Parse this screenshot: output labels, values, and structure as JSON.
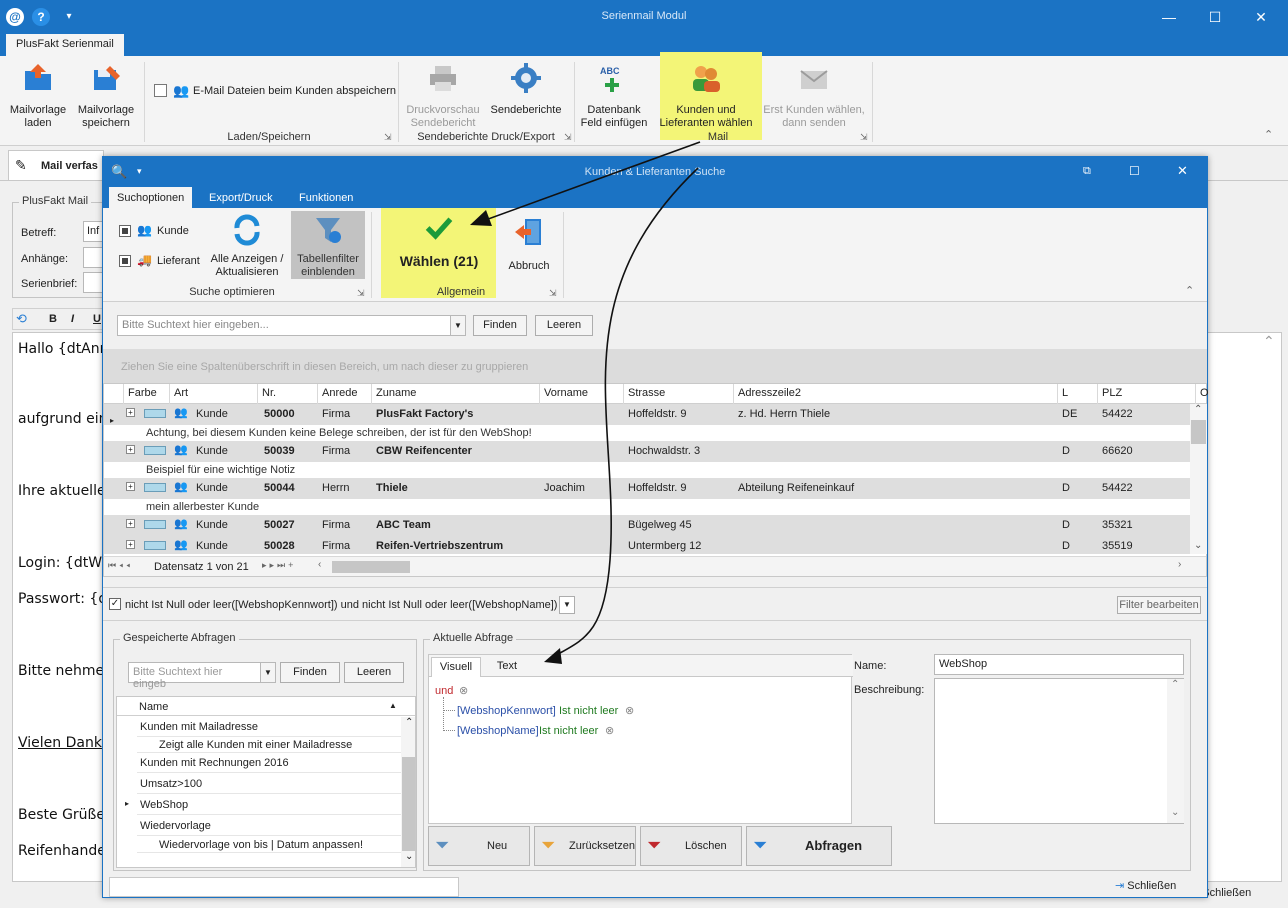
{
  "app": {
    "title": "Serienmail Modul",
    "quick_access": [
      "@",
      "?",
      "▾"
    ],
    "window_controls": [
      "—",
      "☐",
      "✕"
    ]
  },
  "main_ribbon": {
    "tab": "PlusFakt Serienmail",
    "buttons": {
      "mailvorlage_laden": [
        "Mailvorlage",
        "laden"
      ],
      "mailvorlage_speichern": [
        "Mailvorlage",
        "speichern"
      ],
      "email_dateien_checkbox": "E-Mail Dateien beim Kunden abspeichern",
      "druckvorschau": [
        "Druckvorschau",
        "Sendebericht"
      ],
      "sendeberichte": "Sendeberichte",
      "datenbank_feld": [
        "Datenbank",
        "Feld einfügen"
      ],
      "kunden_lieferanten": [
        "Kunden und",
        "Lieferanten wählen"
      ],
      "erst_kunden": [
        "Erst Kunden wählen,",
        "dann senden"
      ]
    },
    "groups": {
      "laden_speichern": "Laden/Speichern",
      "sendeberichte": "Sendeberichte Druck/Export",
      "mail": "Mail"
    }
  },
  "background": {
    "tab_mail": "Mail verfas",
    "plusfakt_mail": "PlusFakt Mail",
    "fields": {
      "betreff_label": "Betreff:",
      "betreff_value": "Inf",
      "anhaenge_label": "Anhänge:",
      "serienbrief_label": "Serienbrief:"
    },
    "editor_toolbar": [
      "B",
      "I",
      "U"
    ],
    "editor_lines": [
      "Hallo {dtAnr",
      "aufgrund ein",
      "Ihre aktuelle",
      "Login: {dtWe",
      "Passwort: {d",
      "Bitte nehme",
      "Vielen Dank",
      "Beste Grüße",
      "Reifenhande"
    ],
    "statusbar_close": "Schließen"
  },
  "dialog": {
    "title": "Kunden & Lieferanten Suche",
    "tabs": [
      "Suchoptionen",
      "Export/Druck",
      "Funktionen"
    ],
    "ribbon": {
      "check_kunde": "Kunde",
      "check_lieferant": "Lieferant",
      "alle_anzeigen": [
        "Alle Anzeigen /",
        "Aktualisieren"
      ],
      "tabellenfilter": [
        "Tabellenfilter",
        "einblenden"
      ],
      "waehlen": "Wählen (21)",
      "abbruch": "Abbruch",
      "group_suche": "Suche optimieren",
      "group_allgemein": "Allgemein"
    },
    "search": {
      "placeholder": "Bitte Suchtext hier eingeben...",
      "find": "Finden",
      "clear": "Leeren"
    },
    "group_hint": "Ziehen Sie eine Spaltenüberschrift in diesen Bereich, um nach dieser zu gruppieren",
    "grid": {
      "columns": [
        "Farbe",
        "Art",
        "Nr.",
        "Anrede",
        "Zuname",
        "Vorname",
        "Strasse",
        "Adresszeile2",
        "L",
        "PLZ",
        "O"
      ],
      "rows": [
        {
          "art": "Kunde",
          "nr": "50000",
          "anrede": "Firma",
          "zuname": "PlusFakt Factory's",
          "vorname": "",
          "strasse": "Hoffeldstr. 9",
          "adresse2": "z. Hd. Herrn Thiele",
          "land": "DE",
          "plz": "54422",
          "note": "Achtung, bei diesem Kunden keine Belege schreiben, der ist für den WebShop!"
        },
        {
          "art": "Kunde",
          "nr": "50039",
          "anrede": "Firma",
          "zuname": "CBW Reifencenter",
          "vorname": "",
          "strasse": "Hochwaldstr. 3",
          "adresse2": "",
          "land": "D",
          "plz": "66620",
          "note": "Beispiel für eine wichtige Notiz"
        },
        {
          "art": "Kunde",
          "nr": "50044",
          "anrede": "Herrn",
          "zuname": "Thiele",
          "vorname": "Joachim",
          "strasse": "Hoffeldstr. 9",
          "adresse2": "Abteilung Reifeneinkauf",
          "land": "D",
          "plz": "54422",
          "note": "mein allerbester Kunde"
        },
        {
          "art": "Kunde",
          "nr": "50027",
          "anrede": "Firma",
          "zuname": "ABC Team",
          "vorname": "",
          "strasse": "Bügelweg 45",
          "adresse2": "",
          "land": "D",
          "plz": "35321",
          "note": ""
        },
        {
          "art": "Kunde",
          "nr": "50028",
          "anrede": "Firma",
          "zuname": "Reifen-Vertriebszentrum",
          "vorname": "",
          "strasse": "Untermberg 12",
          "adresse2": "",
          "land": "D",
          "plz": "35519",
          "note": ""
        }
      ],
      "navigator": "Datensatz 1 von 21"
    },
    "filter_text": "nicht Ist Null oder leer([WebshopKennwort]) und nicht Ist Null oder leer([WebshopName])",
    "filter_edit": "Filter bearbeiten",
    "saved_queries": {
      "legend": "Gespeicherte Abfragen",
      "placeholder": "Bitte Suchtext hier eingeb",
      "find": "Finden",
      "clear": "Leeren",
      "header": "Name",
      "items": [
        {
          "text": "Kunden mit Mailadresse",
          "sub": false
        },
        {
          "text": "Zeigt alle Kunden mit einer Mailadresse",
          "sub": true
        },
        {
          "text": "Kunden mit Rechnungen 2016",
          "sub": false
        },
        {
          "text": "Umsatz>100",
          "sub": false
        },
        {
          "text": "WebShop",
          "sub": false
        },
        {
          "text": "Wiedervorlage",
          "sub": false
        },
        {
          "text": "Wiedervorlage von bis | Datum anpassen!",
          "sub": true
        }
      ]
    },
    "current_query": {
      "legend": "Aktuelle Abfrage",
      "tabs": [
        "Visuell",
        "Text"
      ],
      "operator": "und",
      "conditions": [
        {
          "field": "[WebshopKennwort]",
          "op": "Ist nicht leer"
        },
        {
          "field": "[WebshopName]",
          "op": "Ist nicht leer"
        }
      ],
      "name_label": "Name:",
      "name_value": "WebShop",
      "desc_label": "Beschreibung:",
      "buttons": {
        "neu": "Neu",
        "zuruecksetzen": "Zurücksetzen",
        "loeschen": "Löschen",
        "abfragen": "Abfragen"
      }
    },
    "close": "Schließen"
  },
  "colors": {
    "brand_blue": "#1b73c4",
    "highlight_yellow": "#f3f577",
    "check_green": "#1c9b3a",
    "condition_field": "#2a4fa8",
    "condition_op": "#1f7a1f",
    "operator_red": "#c0282d"
  }
}
